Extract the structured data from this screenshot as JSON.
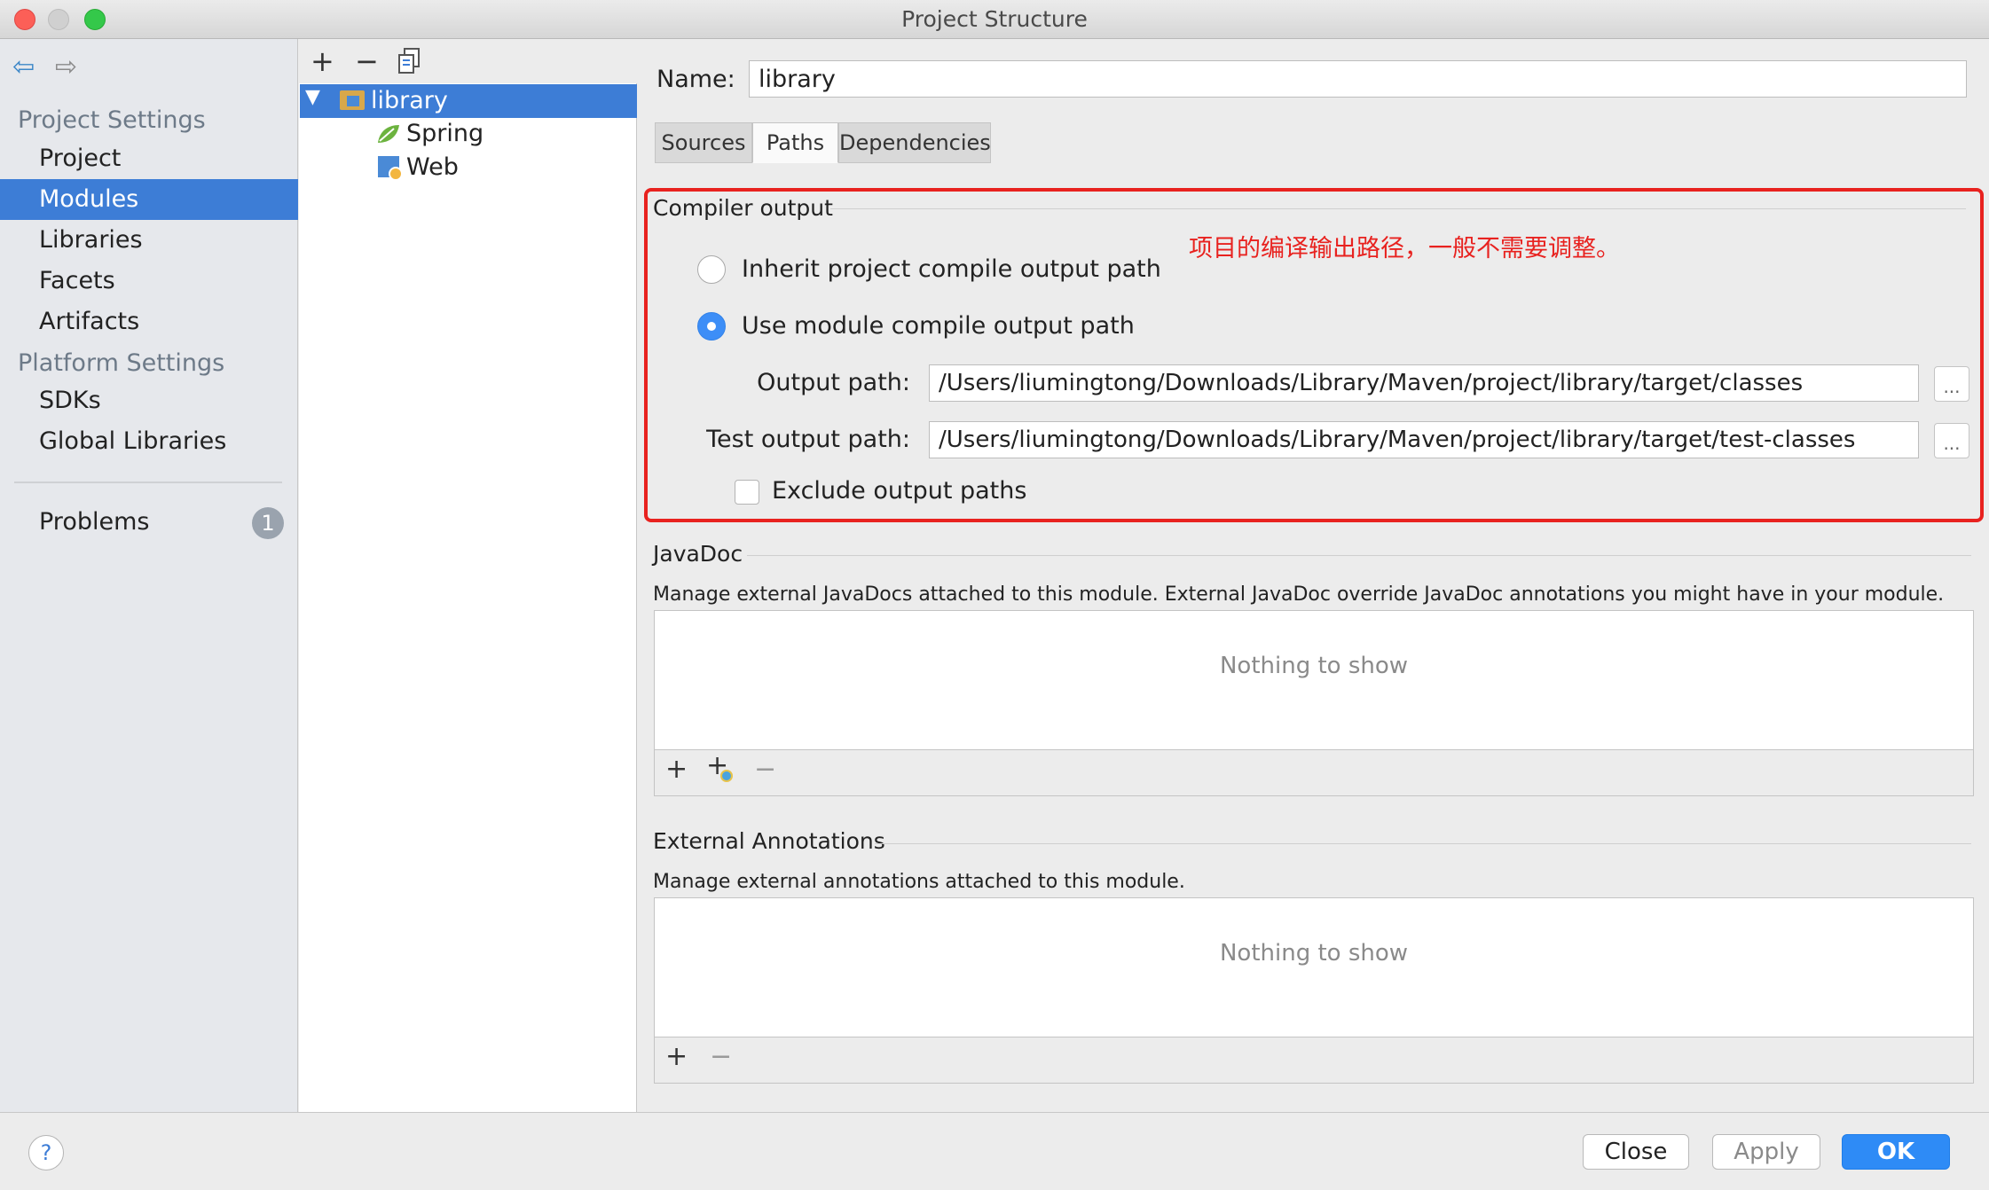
{
  "window": {
    "title": "Project Structure"
  },
  "sidebar": {
    "project_settings_title": "Project Settings",
    "items": [
      {
        "label": "Project"
      },
      {
        "label": "Modules"
      },
      {
        "label": "Libraries"
      },
      {
        "label": "Facets"
      },
      {
        "label": "Artifacts"
      }
    ],
    "platform_settings_title": "Platform Settings",
    "platform_items": [
      {
        "label": "SDKs"
      },
      {
        "label": "Global Libraries"
      }
    ],
    "problems_label": "Problems",
    "problems_count": "1",
    "selected": "Modules"
  },
  "tree": {
    "toolbar": {
      "add": "+",
      "remove": "−"
    },
    "nodes": [
      {
        "label": "library",
        "icon": "folder-icon",
        "selected": true
      },
      {
        "label": "Spring",
        "icon": "spring-leaf-icon"
      },
      {
        "label": "Web",
        "icon": "web-icon"
      }
    ]
  },
  "module": {
    "name_label": "Name:",
    "name_value": "library",
    "tabs": [
      {
        "label": "Sources"
      },
      {
        "label": "Paths",
        "active": true
      },
      {
        "label": "Dependencies"
      }
    ]
  },
  "compiler_output": {
    "title": "Compiler output",
    "annotation": "项目的编译输出路径，一般不需要调整。",
    "option_inherit": "Inherit project compile output path",
    "option_module": "Use module compile output path",
    "selected_option": "Use module compile output path",
    "output_path_label": "Output path:",
    "output_path_value": "/Users/liumingtong/Downloads/Library/Maven/project/library/target/classes",
    "test_output_path_label": "Test output path:",
    "test_output_path_value": "/Users/liumingtong/Downloads/Library/Maven/project/library/target/test-classes",
    "browse_label": "...",
    "exclude_label": "Exclude output paths",
    "exclude_checked": false
  },
  "javadoc": {
    "title": "JavaDoc",
    "description": "Manage external JavaDocs attached to this module. External JavaDoc override JavaDoc annotations you might have in your module.",
    "empty_text": "Nothing to show",
    "toolbar": {
      "add": "+",
      "add_url": "+",
      "remove": "−"
    }
  },
  "external_annotations": {
    "title": "External Annotations",
    "description": "Manage external annotations attached to this module.",
    "empty_text": "Nothing to show",
    "toolbar": {
      "add": "+",
      "remove": "−"
    }
  },
  "footer": {
    "help": "?",
    "close": "Close",
    "apply": "Apply",
    "ok": "OK"
  },
  "colors": {
    "selection": "#3d7dd6",
    "annotation_red": "#e8221f",
    "ok_button": "#2e8bf6"
  }
}
